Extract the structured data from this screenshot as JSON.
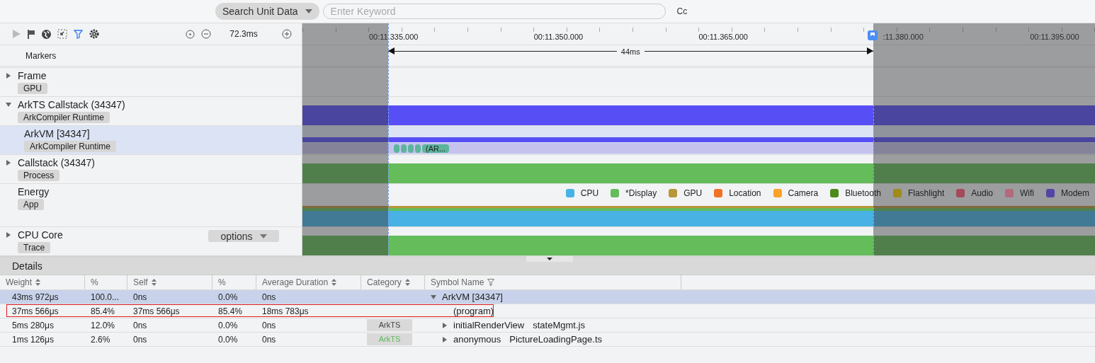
{
  "top_bar": {
    "search_scope": "Search Unit Data",
    "keyword_placeholder": "Enter Keyword",
    "case_toggle": "Cc"
  },
  "toolbar": {
    "filter_active": true,
    "zoom_span": "72.3ms"
  },
  "markers_label": "Markers",
  "ruler": {
    "labels": [
      "00:11.335.000",
      "00:11.350.000",
      "00:11.365.000",
      ":11.380.000",
      "00:11.395.000"
    ],
    "measure": "44ms"
  },
  "tracks": [
    {
      "name": "Frame",
      "tag": "GPU",
      "expanded": false,
      "selected": false,
      "lane": {
        "kind": "empty"
      }
    },
    {
      "name": "ArkTS Callstack (34347)",
      "tag": "ArkCompiler Runtime",
      "expanded": true,
      "selected": false,
      "lane": {
        "kind": "bar",
        "color": "#574ff5"
      },
      "children": [
        {
          "name": "ArkVM [34347]",
          "tag": "ArkCompiler Runtime",
          "selected": true,
          "lane": {
            "kind": "slices",
            "slice_label": "(AR..."
          }
        }
      ]
    },
    {
      "name": "Callstack (34347)",
      "tag": "Process",
      "expanded": false,
      "selected": false,
      "lane": {
        "kind": "bar",
        "color": "#64bc5b"
      }
    },
    {
      "name": "Energy",
      "tag": "App",
      "selected": false,
      "lane": {
        "kind": "energy",
        "legend": [
          {
            "name": "CPU",
            "color": "#47b2e3"
          },
          {
            "name": "*Display",
            "color": "#64bc5b"
          },
          {
            "name": "GPU",
            "color": "#b8963c"
          },
          {
            "name": "Location",
            "color": "#f07227"
          },
          {
            "name": "Camera",
            "color": "#f9a227"
          },
          {
            "name": "Bluetooth",
            "color": "#4d8a1b"
          },
          {
            "name": "Flashlight",
            "color": "#a08a1a"
          },
          {
            "name": "Audio",
            "color": "#a54a5a"
          },
          {
            "name": "Wifi",
            "color": "#b16b7b"
          },
          {
            "name": "Modem",
            "color": "#5146a6"
          }
        ]
      }
    },
    {
      "name": "CPU Core",
      "tag": "Trace",
      "expanded": false,
      "selected": false,
      "options": "options",
      "lane": {
        "kind": "bar",
        "color": "#64bc5b"
      }
    }
  ],
  "details": {
    "title": "Details",
    "columns": [
      {
        "label": "Weight",
        "kind": "sortable"
      },
      {
        "label": "%",
        "kind": "plain"
      },
      {
        "label": "Self",
        "kind": "sortable"
      },
      {
        "label": "%",
        "kind": "plain"
      },
      {
        "label": "Average Duration",
        "kind": "sortable"
      },
      {
        "label": "Category",
        "kind": "sortable"
      },
      {
        "label": "Symbol Name",
        "kind": "filterable"
      }
    ],
    "rows": [
      {
        "cells": [
          "43ms 972μs",
          "100.0...",
          "0ns",
          "0.0%",
          "0ns"
        ],
        "symbol": "ArkVM [34347]",
        "expanded": true,
        "selected": true,
        "highlighted": false,
        "children": [
          {
            "cells": [
              "37ms 566μs",
              "85.4%",
              "37ms 566μs",
              "85.4%",
              "18ms 783μs"
            ],
            "symbol": "(program)",
            "selected": false,
            "highlighted": true
          },
          {
            "cells": [
              "5ms 280μs",
              "12.0%",
              "0ns",
              "0.0%",
              "0ns"
            ],
            "category": {
              "label": "ArkTS",
              "color": "#444444"
            },
            "symbol": "initialRenderView",
            "file": "stateMgmt.js",
            "expanded": false,
            "selected": false,
            "highlighted": false
          },
          {
            "cells": [
              "1ms 126μs",
              "2.6%",
              "0ns",
              "0.0%",
              "0ns"
            ],
            "category": {
              "label": "ArkTS",
              "color": "#5cb85c"
            },
            "symbol": "anonymous",
            "file": "PictureLoadingPage.ts",
            "expanded": false,
            "selected": false,
            "highlighted": false
          }
        ]
      }
    ]
  }
}
